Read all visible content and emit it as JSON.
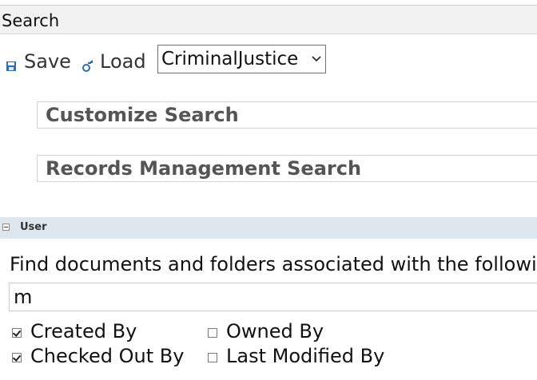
{
  "panel": {
    "title": "Search"
  },
  "toolbar": {
    "save_label": "Save",
    "load_label": "Load",
    "select": {
      "selected": "CriminalJustice"
    }
  },
  "sections": {
    "customize_title": "Customize Search",
    "records_title": "Records Management Search"
  },
  "user": {
    "title": "User",
    "description": "Find documents and folders associated with the followi",
    "input_value": "m",
    "checkboxes": {
      "created_by": {
        "label": "Created By",
        "checked": true
      },
      "owned_by": {
        "label": "Owned By",
        "checked": false
      },
      "checked_out_by": {
        "label": "Checked Out By",
        "checked": true
      },
      "last_modified_by": {
        "label": "Last Modified By",
        "checked": false
      }
    }
  },
  "colors": {
    "header_bg": "#f2f2f2",
    "user_band_bg": "#dfe7ee",
    "icon_blue": "#2f6fa5"
  }
}
